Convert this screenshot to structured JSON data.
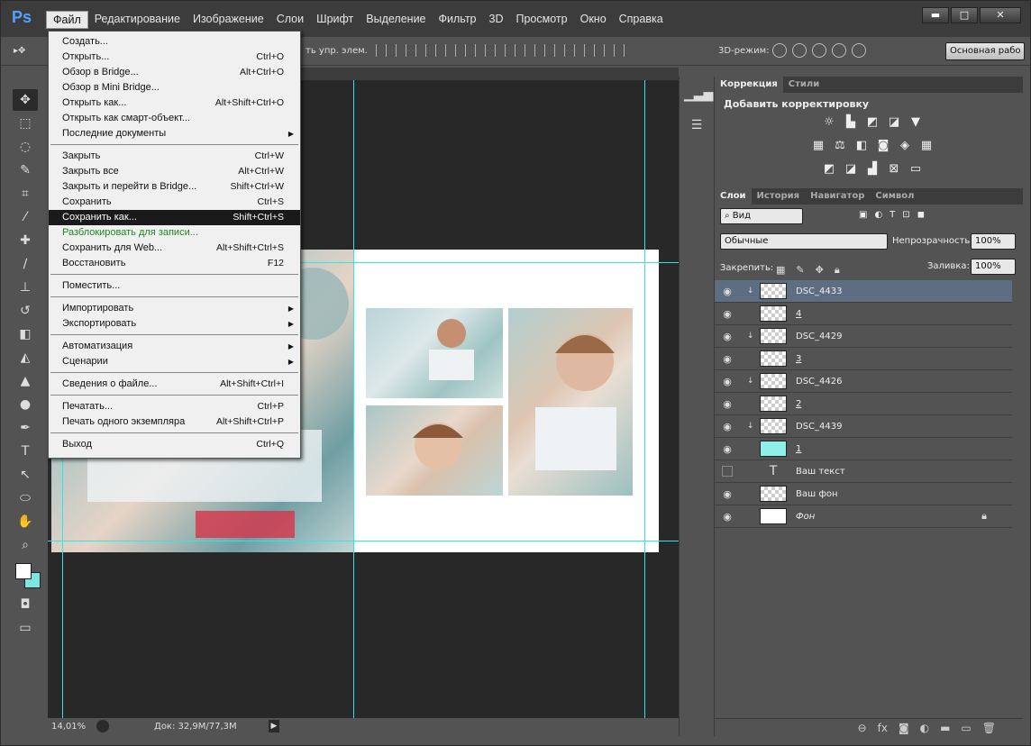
{
  "app": {
    "logo": "Ps"
  },
  "menubar": {
    "items": [
      "Файл",
      "Редактирование",
      "Изображение",
      "Слои",
      "Шрифт",
      "Выделение",
      "Фильтр",
      "3D",
      "Просмотр",
      "Окно",
      "Справка"
    ],
    "active_index": 0,
    "window_buttons": [
      "▬",
      "□",
      "✕"
    ]
  },
  "options_bar": {
    "show_controls_label": "ть упр. элем.",
    "mode_3d_label": "3D-режим:",
    "workspace": "Основная рабо"
  },
  "file_menu": {
    "groups": [
      [
        {
          "label": "Создать...",
          "shortcut": ""
        },
        {
          "label": "Открыть...",
          "shortcut": "Ctrl+O"
        },
        {
          "label": "Обзор в Bridge...",
          "shortcut": "Alt+Ctrl+O"
        },
        {
          "label": "Обзор в Mini Bridge...",
          "shortcut": ""
        },
        {
          "label": "Открыть как...",
          "shortcut": "Alt+Shift+Ctrl+O"
        },
        {
          "label": "Открыть как смарт-объект...",
          "shortcut": ""
        },
        {
          "label": "Последние документы",
          "shortcut": "",
          "submenu": true
        }
      ],
      [
        {
          "label": "Закрыть",
          "shortcut": "Ctrl+W"
        },
        {
          "label": "Закрыть все",
          "shortcut": "Alt+Ctrl+W"
        },
        {
          "label": "Закрыть и перейти в Bridge...",
          "shortcut": "Shift+Ctrl+W"
        },
        {
          "label": "Сохранить",
          "shortcut": "Ctrl+S"
        },
        {
          "label": "Сохранить как...",
          "shortcut": "Shift+Ctrl+S",
          "highlighted": true
        },
        {
          "label": "Разблокировать для записи...",
          "shortcut": "",
          "green": true
        },
        {
          "label": "Сохранить для Web...",
          "shortcut": "Alt+Shift+Ctrl+S"
        },
        {
          "label": "Восстановить",
          "shortcut": "F12"
        }
      ],
      [
        {
          "label": "Поместить...",
          "shortcut": ""
        }
      ],
      [
        {
          "label": "Импортировать",
          "shortcut": "",
          "submenu": true
        },
        {
          "label": "Экспортировать",
          "shortcut": "",
          "submenu": true
        }
      ],
      [
        {
          "label": "Автоматизация",
          "shortcut": "",
          "submenu": true
        },
        {
          "label": "Сценарии",
          "shortcut": "",
          "submenu": true
        }
      ],
      [
        {
          "label": "Сведения о файле...",
          "shortcut": "Alt+Shift+Ctrl+I"
        }
      ],
      [
        {
          "label": "Печатать...",
          "shortcut": "Ctrl+P"
        },
        {
          "label": "Печать одного экземпляра",
          "shortcut": "Alt+Shift+Ctrl+P"
        }
      ],
      [
        {
          "label": "Выход",
          "shortcut": "Ctrl+Q"
        }
      ]
    ]
  },
  "status": {
    "zoom": "14,01%",
    "doc_size": "Док: 32,9M/77,3M"
  },
  "adjustments_panel": {
    "tabs": [
      "Коррекция",
      "Стили"
    ],
    "title": "Добавить корректировку"
  },
  "layers_panel": {
    "tabs": [
      "Слои",
      "История",
      "Навигатор",
      "Символ"
    ],
    "filter_kind": "Вид",
    "blend_mode": "Обычные",
    "opacity_label": "Непрозрачность:",
    "opacity": "100%",
    "lock_label": "Закрепить:",
    "fill_label": "Заливка:",
    "fill": "100%",
    "layers": [
      {
        "name": "DSC_4433",
        "type": "photo",
        "clipped": true,
        "visible": true,
        "selected": true
      },
      {
        "name": "4",
        "type": "shape",
        "clipped": false,
        "visible": true
      },
      {
        "name": "DSC_4429",
        "type": "photo",
        "clipped": true,
        "visible": true
      },
      {
        "name": "3",
        "type": "shape",
        "clipped": false,
        "visible": true
      },
      {
        "name": "DSC_4426",
        "type": "photo",
        "clipped": true,
        "visible": true
      },
      {
        "name": "2",
        "type": "shape",
        "clipped": false,
        "visible": true
      },
      {
        "name": "DSC_4439",
        "type": "photo",
        "clipped": true,
        "visible": true
      },
      {
        "name": "1",
        "type": "shape-cyan",
        "clipped": false,
        "visible": true
      },
      {
        "name": "Ваш текст",
        "type": "text",
        "clipped": false,
        "visible": false
      },
      {
        "name": "Ваш фон",
        "type": "transparent",
        "clipped": false,
        "visible": true
      },
      {
        "name": "Фон",
        "type": "background",
        "clipped": false,
        "visible": true,
        "locked": true
      }
    ]
  }
}
